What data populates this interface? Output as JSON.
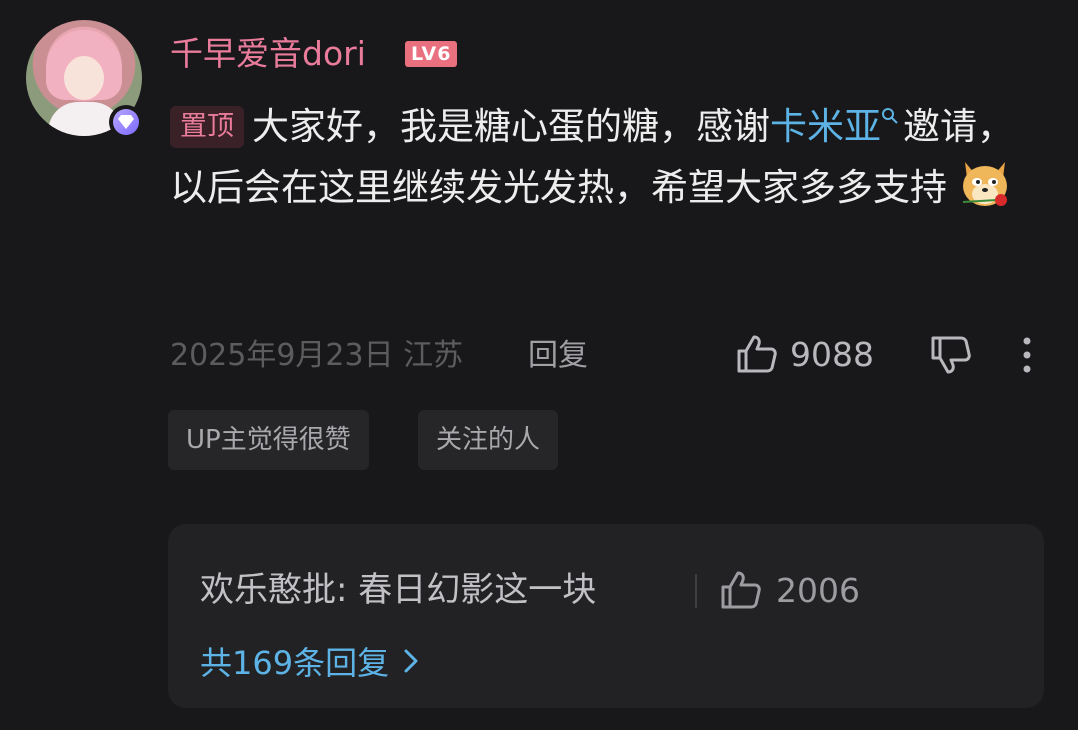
{
  "comment": {
    "username": "千早爱音dori",
    "level": "LV6",
    "pinned_label": "置顶",
    "text_before": "大家好，我是糖心蛋的糖，感谢",
    "mention": "卡米亚",
    "text_after": "邀请，以后会在这里继续发光发热，希望大家多多支持",
    "meta": "2025年9月23日 江苏",
    "reply_label": "回复",
    "like_count": "9088"
  },
  "tags": [
    "UP主觉得很赞",
    "关注的人"
  ],
  "sub_reply": {
    "text": "欢乐憨批: 春日幻影这一块",
    "like_count": "2006",
    "more_label": "共169条回复"
  },
  "colors": {
    "background": "#18181a",
    "username": "#e97b9b",
    "mention": "#5db3e5",
    "level_badge": "#e9707f"
  },
  "icons": [
    "thumbs-up-icon",
    "thumbs-down-icon",
    "more-vertical-icon",
    "search-icon",
    "chevron-right-icon",
    "diamond-icon",
    "doge-rose-emoji"
  ]
}
